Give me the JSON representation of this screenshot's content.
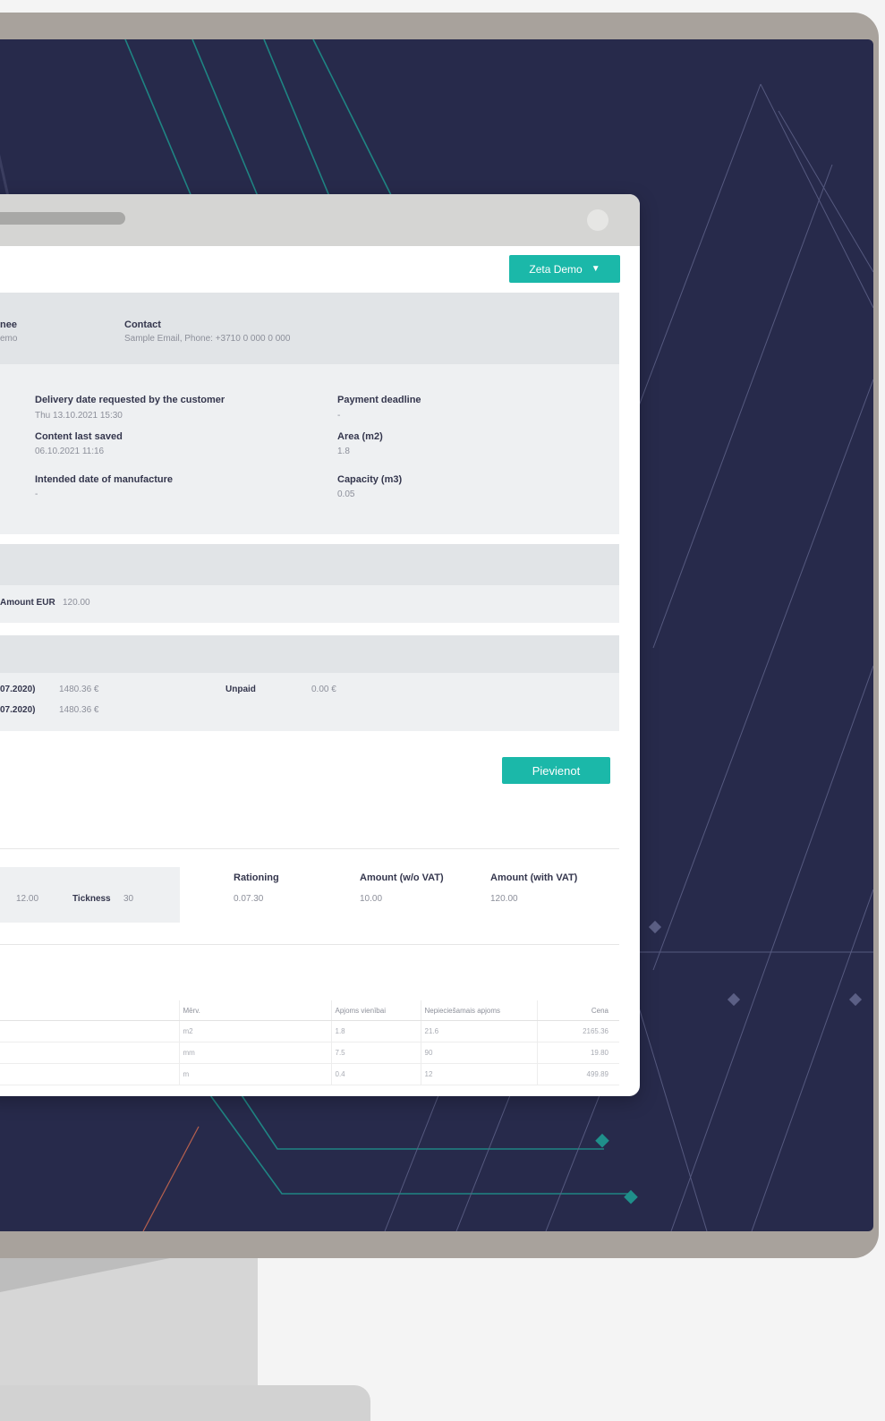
{
  "header": {
    "user_menu_label": "Zeta Demo"
  },
  "top_panel": {
    "assignee_label": "nee",
    "assignee_value": "emo",
    "contact_label": "Contact",
    "contact_value": "Sample Email, Phone: +3710 0 000 0 000"
  },
  "details": {
    "delivery_label": "Delivery date requested by the customer",
    "delivery_value": "Thu 13.10.2021 15:30",
    "saved_label": "Content last saved",
    "saved_value": "06.10.2021 11:16",
    "manufacture_label": "Intended date of manufacture",
    "manufacture_value": "-",
    "payment_label": "Payment deadline",
    "payment_value": "-",
    "area_label": "Area (m2)",
    "area_value": "1.8",
    "capacity_label": "Capacity (m3)",
    "capacity_value": "0.05"
  },
  "amount_row": {
    "label": "Amount EUR",
    "value": "120.00"
  },
  "payments": {
    "row1_date": "07.2020)",
    "row1_amount": "1480.36 €",
    "row2_date": "07.2020)",
    "row2_amount": "1480.36 €",
    "unpaid_label": "Unpaid",
    "unpaid_value": "0.00 €"
  },
  "add_button_label": "Pievienot",
  "product": {
    "dim_value": "12.00",
    "thickness_label": "Tickness",
    "thickness_value": "30",
    "rationing_label": "Rationing",
    "rationing_value": "0.07.30",
    "amount_novat_label": "Amount (w/o VAT)",
    "amount_novat_value": "10.00",
    "amount_vat_label": "Amount (with VAT)",
    "amount_vat_value": "120.00"
  },
  "spec_table": {
    "headers": [
      "",
      "Mērv.",
      "Apjoms vienībai",
      "Nepieciešamais apjoms",
      "Cena"
    ],
    "rows": [
      [
        "",
        "m2",
        "1.8",
        "21.6",
        "2165.36"
      ],
      [
        "",
        "mm",
        "7.5",
        "90",
        "19.80"
      ],
      [
        "",
        "m",
        "0.4",
        "12",
        "499.89"
      ]
    ]
  },
  "colors": {
    "accent": "#1bb8a9",
    "screen": "#272a4b",
    "frame": "#a8a29c"
  }
}
